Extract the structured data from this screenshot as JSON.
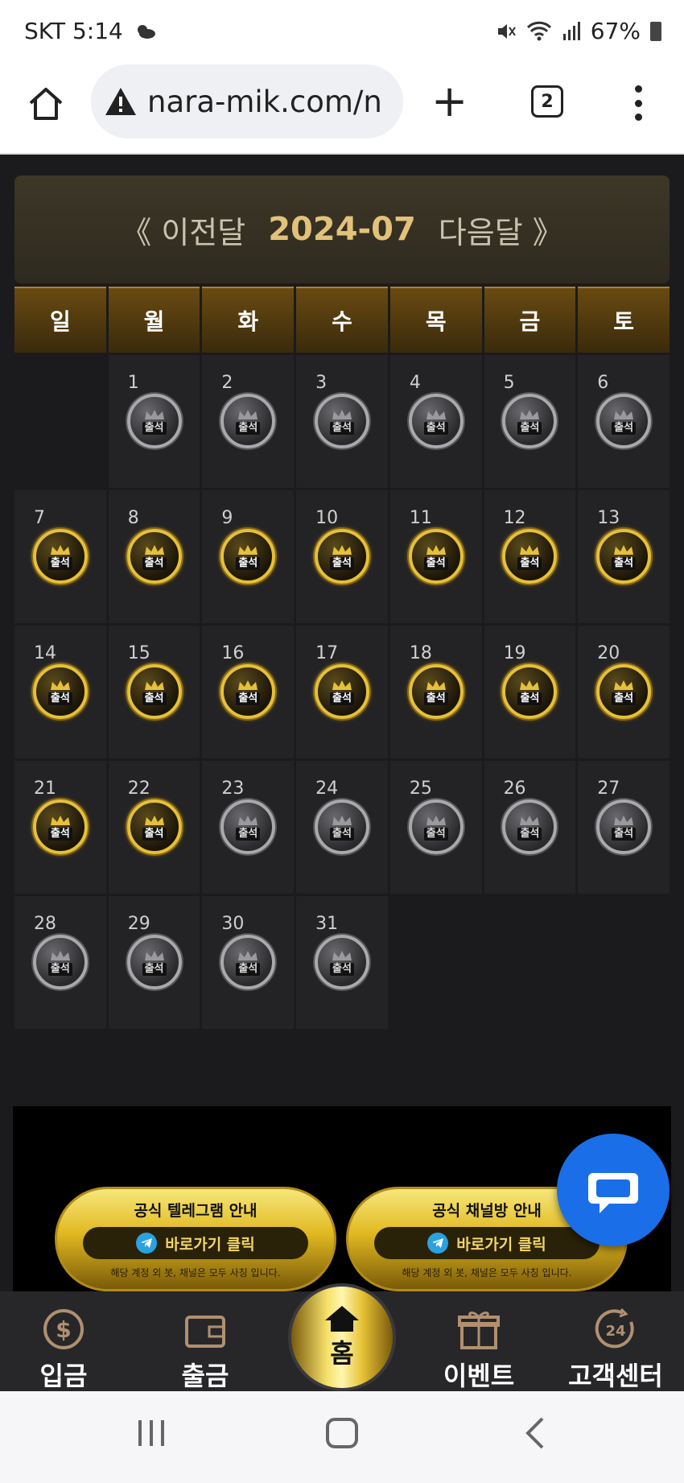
{
  "status_bar": {
    "carrier_time": "SKT 5:14",
    "battery": "67%"
  },
  "browser": {
    "url": "nara-mik.com/n",
    "tab_count": "2"
  },
  "calendar": {
    "prev_label": "《 이전달",
    "current": "2024-07",
    "next_label": "다음달 》",
    "weekdays": [
      "일",
      "월",
      "화",
      "수",
      "목",
      "금",
      "토"
    ],
    "badge_label": "출석",
    "start_offset": 1,
    "days": [
      {
        "day": "1",
        "attended": false
      },
      {
        "day": "2",
        "attended": false
      },
      {
        "day": "3",
        "attended": false
      },
      {
        "day": "4",
        "attended": false
      },
      {
        "day": "5",
        "attended": false
      },
      {
        "day": "6",
        "attended": false
      },
      {
        "day": "7",
        "attended": true
      },
      {
        "day": "8",
        "attended": true
      },
      {
        "day": "9",
        "attended": true
      },
      {
        "day": "10",
        "attended": true
      },
      {
        "day": "11",
        "attended": true
      },
      {
        "day": "12",
        "attended": true
      },
      {
        "day": "13",
        "attended": true
      },
      {
        "day": "14",
        "attended": true
      },
      {
        "day": "15",
        "attended": true
      },
      {
        "day": "16",
        "attended": true
      },
      {
        "day": "17",
        "attended": true
      },
      {
        "day": "18",
        "attended": true
      },
      {
        "day": "19",
        "attended": true
      },
      {
        "day": "20",
        "attended": true
      },
      {
        "day": "21",
        "attended": true
      },
      {
        "day": "22",
        "attended": true
      },
      {
        "day": "23",
        "attended": false
      },
      {
        "day": "24",
        "attended": false
      },
      {
        "day": "25",
        "attended": false
      },
      {
        "day": "26",
        "attended": false
      },
      {
        "day": "27",
        "attended": false
      },
      {
        "day": "28",
        "attended": false
      },
      {
        "day": "29",
        "attended": false
      },
      {
        "day": "30",
        "attended": false
      },
      {
        "day": "31",
        "attended": false
      }
    ]
  },
  "promos": [
    {
      "title": "공식 텔레그램 안내",
      "button": "바로가기 클릭",
      "note": "해당 계정 외 봇, 채널은 모두 사칭 입니다."
    },
    {
      "title": "공식 채널방 안내",
      "button": "바로가기 클릭",
      "note": "해당 계정 외 봇, 채널은 모두 사칭 입니다."
    }
  ],
  "bottom_nav": {
    "deposit": "입금",
    "withdraw": "출금",
    "home": "홈",
    "event": "이벤트",
    "support": "고객센터"
  },
  "colors": {
    "gold": "#e6c03a",
    "silver": "#a9a9ad",
    "chat": "#1a6fe8"
  }
}
